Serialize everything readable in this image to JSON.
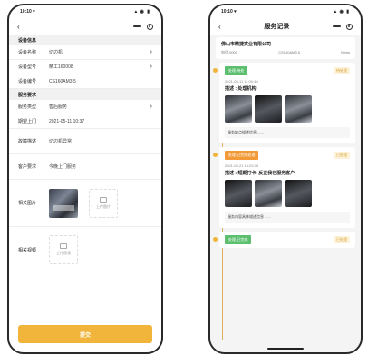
{
  "left": {
    "status": {
      "time": "10:10 ▾",
      "icons": "▴ ◉ ▮"
    },
    "nav": {
      "back": "‹"
    },
    "section_device": "设备信息",
    "rows_device": [
      {
        "label": "设备名称",
        "value": "切边机"
      },
      {
        "label": "设备型号",
        "value": "精工160008"
      },
      {
        "label": "设备编号",
        "value": "CS160AM3.5"
      }
    ],
    "section_service": "服务要求",
    "rows_service": [
      {
        "label": "服务类型",
        "value": "售后服务"
      },
      {
        "label": "期望上门",
        "value": "2021-05-11 10:37"
      },
      {
        "label": "故障描述",
        "value": "切边机异常"
      },
      {
        "label": "客户要求",
        "value": "今晚上门服务"
      }
    ],
    "photo_label": "相关图片",
    "upload_photo": "上传图片",
    "video_label": "相关视频",
    "upload_video": "上传视频",
    "submit": "提交"
  },
  "right": {
    "status": {
      "time": "10:10 ▾",
      "icons": "▴ ◉ ▮"
    },
    "nav": {
      "back": "‹",
      "title": "服务记录"
    },
    "company": {
      "name": "佛山市精捷实业有限公司",
      "meta_left": "电话:0000",
      "meta_mid": "CS160AM3.5",
      "meta_right": "Mtms"
    },
    "records": [
      {
        "badge": "处理-待处",
        "status": "待处理",
        "time": "2021-05-11 11:00:40",
        "desc": "描述 : 处理机构",
        "foot": "服务地点描述信息 ......"
      },
      {
        "badge": "处理-已完成处理",
        "status": "已处理",
        "time": "2021-05-21 16:03:35",
        "desc": "描述 : 短期打卡, 反正我已服务客户",
        "foot": "服务内容具体描述信息 ......"
      },
      {
        "badge": "处理-已完成",
        "status": "已处理"
      }
    ]
  },
  "colors": {
    "accent": "#f0b53a",
    "green": "#5bbf6e",
    "orange": "#f39a38"
  }
}
